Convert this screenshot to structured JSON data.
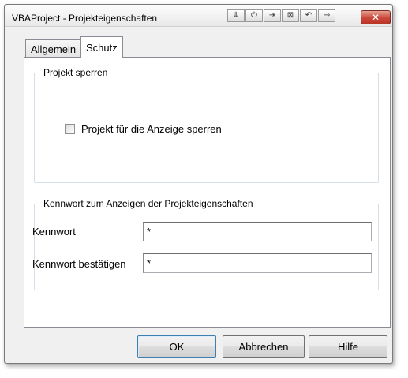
{
  "window": {
    "title": "VBAProject - Projekteigenschaften",
    "title_tools": [
      {
        "icon": "pin-down-icon",
        "glyph": "⇓"
      },
      {
        "icon": "power-icon",
        "glyph": "⏻"
      },
      {
        "icon": "import-icon",
        "glyph": "⇥"
      },
      {
        "icon": "grid-icon",
        "glyph": "⊠"
      },
      {
        "icon": "undo-icon",
        "glyph": "↶"
      },
      {
        "icon": "connect-icon",
        "glyph": "⊸"
      }
    ],
    "close_glyph": "✕"
  },
  "tabs": [
    {
      "label": "Allgemein",
      "selected": false
    },
    {
      "label": "Schutz",
      "selected": true
    }
  ],
  "lock_group": {
    "legend": "Projekt sperren",
    "checkbox_label": "Projekt für die Anzeige sperren",
    "checked": false
  },
  "password_group": {
    "legend": "Kennwort zum Anzeigen der Projekteigenschaften",
    "password_label": "Kennwort",
    "password_value": "*",
    "confirm_label": "Kennwort bestätigen",
    "confirm_value": "*"
  },
  "buttons": {
    "ok": "OK",
    "cancel": "Abbrechen",
    "help": "Hilfe"
  },
  "colors": {
    "dialog_bg": "#f0f0f0",
    "panel_bg": "#ffffff",
    "close_button": "#c9473a",
    "default_button_border": "#3c7fb1"
  }
}
